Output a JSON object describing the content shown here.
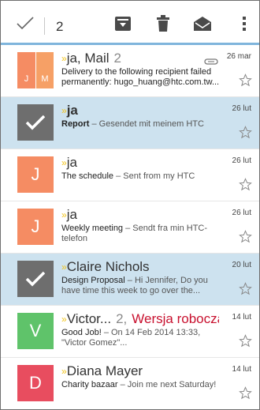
{
  "toolbar": {
    "selected_count": "2",
    "accent": "#7fb5dc",
    "icons": [
      "check-icon",
      "archive-icon",
      "trash-icon",
      "mark-read-icon",
      "overflow-menu-icon"
    ]
  },
  "colors": {
    "selected_row": "#cde2ef",
    "avatar_orange": "#f58c63",
    "avatar_green": "#5fc36a",
    "avatar_red": "#e84d5f",
    "draft_red": "#c8102e",
    "priority_yellow": "#f2c318"
  },
  "messages": [
    {
      "avatar": "J M",
      "initials": [
        "J",
        "M"
      ],
      "sender": "ja, Mail",
      "thread_count": "2",
      "subject": "Delivery to the following recipient failed permanently: hugo_huang@htc.com.tw...",
      "date": "26 mar",
      "has_attachment": true,
      "selected": false
    },
    {
      "avatar": "check",
      "sender": "ja",
      "subject": "Report",
      "preview": " – Gesendet mit meinem HTC",
      "date": "26 lut",
      "selected": true
    },
    {
      "avatar": "J",
      "sender": "ja",
      "subject": "The schedule",
      "preview": " – Sent from my HTC",
      "date": "26 lut",
      "selected": false
    },
    {
      "avatar": "J",
      "sender": "ja",
      "subject": "Weekly meeting",
      "preview": " – Sendt fra min HTC-telefon",
      "date": "26 lut",
      "selected": false
    },
    {
      "avatar": "check",
      "sender": "Claire Nichols",
      "subject": "Design Proposal",
      "preview": " – Hi Jennifer, Do you have time this week to go over the...",
      "date": "20 lut",
      "selected": true
    },
    {
      "avatar": "V",
      "sender": "Victor...",
      "thread_count": "2,",
      "draft_label": "Wersja robocza",
      "subject": "Good Job!",
      "preview": " – On 14 Feb 2014 13:33, \"Victor Gomez\"...",
      "date": "14 lut",
      "selected": false
    },
    {
      "avatar": "D",
      "sender": "Diana Mayer",
      "subject": "Charity bazaar",
      "preview": " – Join me next Saturday!",
      "date": "14 lut",
      "selected": false
    }
  ]
}
